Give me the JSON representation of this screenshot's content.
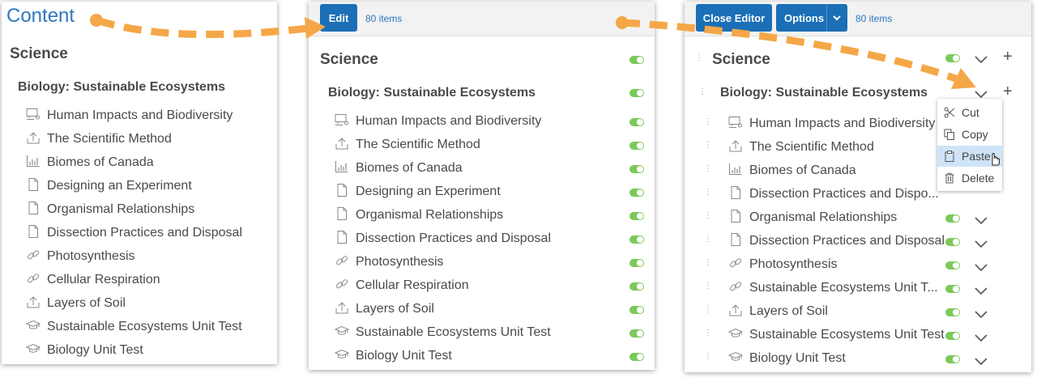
{
  "panel1": {
    "title": "Content",
    "section": "Science",
    "group": "Biology: Sustainable Ecosystems"
  },
  "panel2": {
    "edit_label": "Edit",
    "count": "80 items",
    "section": "Science",
    "group": "Biology: Sustainable Ecosystems"
  },
  "panel3": {
    "close_label": "Close Editor",
    "options_label": "Options",
    "count": "80 items",
    "section": "Science",
    "group": "Biology: Sustainable Ecosystems",
    "menu": {
      "cut": "Cut",
      "copy": "Copy",
      "paste": "Paste",
      "delete": "Delete"
    },
    "truncated": {
      "3": "Dissection Practices and Dispo...",
      "7": "Sustainable Ecosystems Unit T..."
    }
  },
  "items": [
    {
      "label": "Human Impacts and Biodiversity",
      "icon": "discussion-icon"
    },
    {
      "label": "The Scientific Method",
      "icon": "upload-icon"
    },
    {
      "label": "Biomes of Canada",
      "icon": "chart-icon"
    },
    {
      "label": "Designing an Experiment",
      "icon": "document-icon"
    },
    {
      "label": "Organismal Relationships",
      "icon": "document-icon"
    },
    {
      "label": "Dissection Practices and Disposal",
      "icon": "document-icon"
    },
    {
      "label": "Photosynthesis",
      "icon": "link-icon"
    },
    {
      "label": "Cellular Respiration",
      "icon": "link-icon"
    },
    {
      "label": "Layers of Soil",
      "icon": "upload-icon"
    },
    {
      "label": "Sustainable Ecosystems Unit Test",
      "icon": "quiz-icon"
    },
    {
      "label": "Biology Unit Test",
      "icon": "quiz-icon"
    }
  ],
  "colors": {
    "accent": "#1b6fb7",
    "link": "#2e77c0",
    "toggle_on": "#7bc95a",
    "arrow": "#f5a747"
  }
}
